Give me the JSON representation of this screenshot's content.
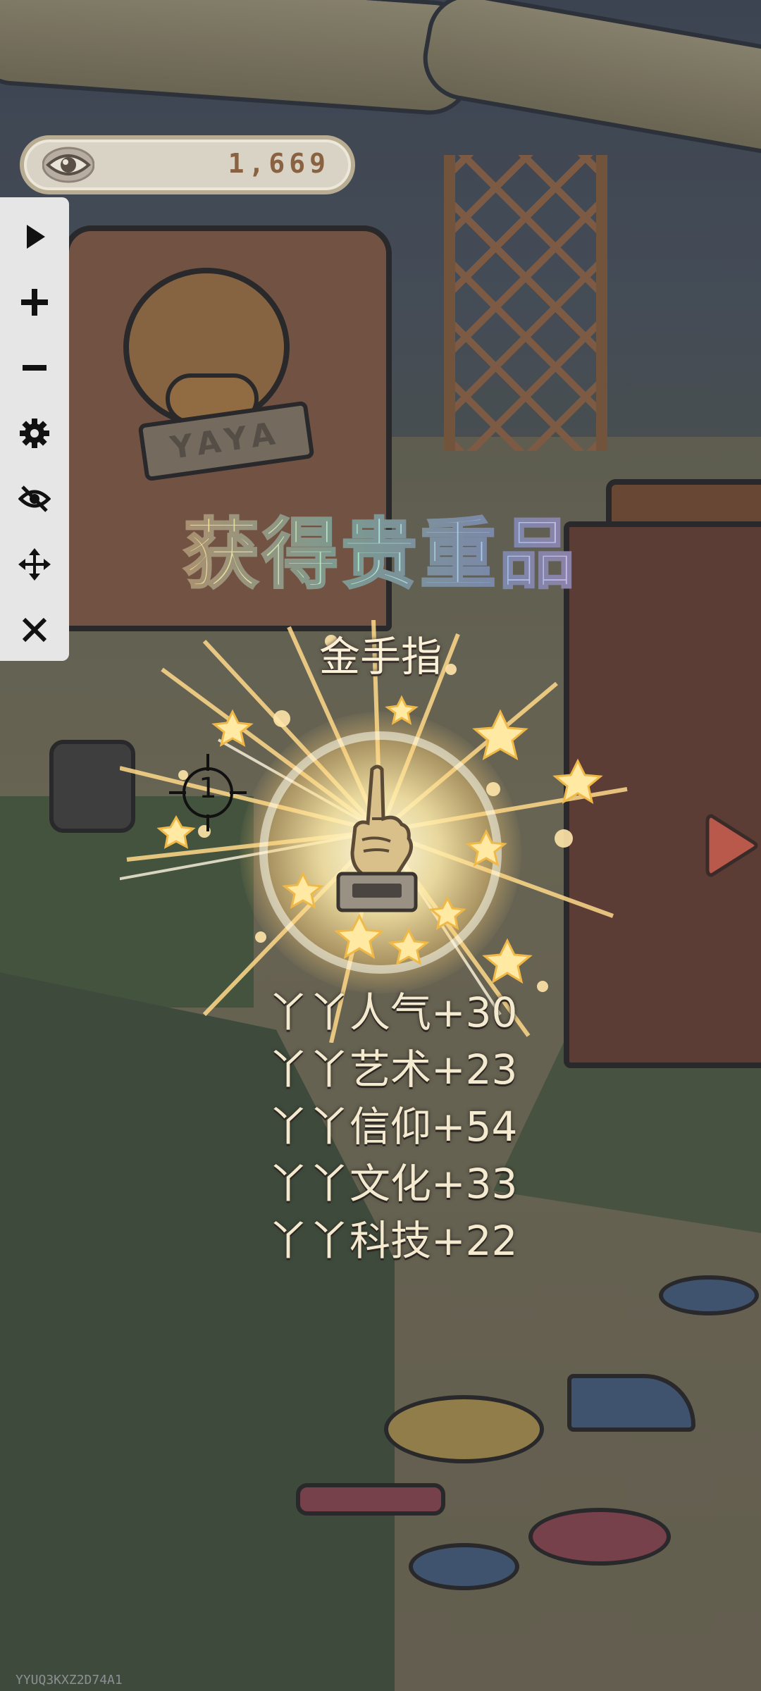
{
  "top_bar": {
    "currency_value": "1,669",
    "currency_icon": "eye-icon"
  },
  "toolbar": {
    "items": [
      {
        "icon": "play-icon"
      },
      {
        "icon": "plus-icon"
      },
      {
        "icon": "minus-icon"
      },
      {
        "icon": "gear-icon"
      },
      {
        "icon": "eye-off-icon"
      },
      {
        "icon": "move-icon"
      },
      {
        "icon": "close-icon"
      }
    ]
  },
  "reward_dialog": {
    "title": "获得贵重品",
    "item_name": "金手指",
    "item_icon": "golden-finger-icon",
    "stats": [
      "丫丫人气+30",
      "丫丫艺术+23",
      "丫丫信仰+54",
      "丫丫文化+33",
      "丫丫科技+22"
    ]
  },
  "crosshair": {
    "number": "1"
  },
  "scene": {
    "sign_text": "YAYA"
  },
  "footer": {
    "code": "YYUQ3KXZ2D74A1"
  }
}
